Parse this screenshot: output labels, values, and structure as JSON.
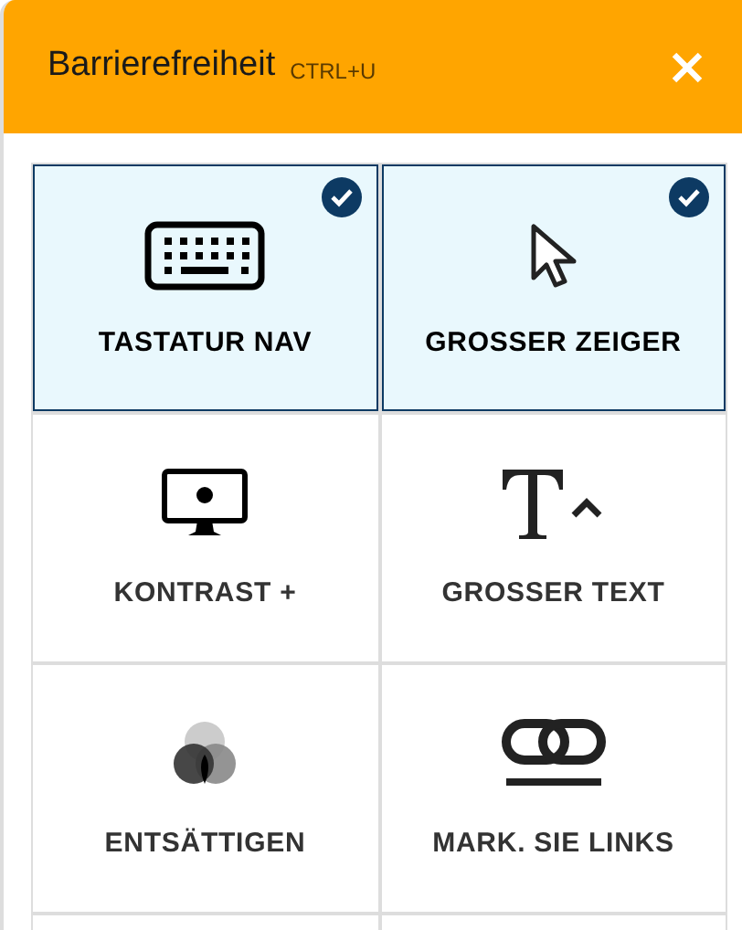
{
  "header": {
    "title": "Barrierefreiheit",
    "shortcut": "CTRL+U"
  },
  "tools": [
    {
      "kind": "keyboard",
      "label": "TASTATUR NAV",
      "selected": true
    },
    {
      "kind": "pointer",
      "label": "GROSSER ZEIGER",
      "selected": true
    },
    {
      "kind": "contrast",
      "label": "KONTRAST +",
      "selected": false
    },
    {
      "kind": "text",
      "label": "GROSSER TEXT",
      "selected": false
    },
    {
      "kind": "desaturate",
      "label": "ENTSÄTTIGEN",
      "selected": false
    },
    {
      "kind": "links",
      "label": "MARK. SIE LINKS",
      "selected": false
    }
  ]
}
